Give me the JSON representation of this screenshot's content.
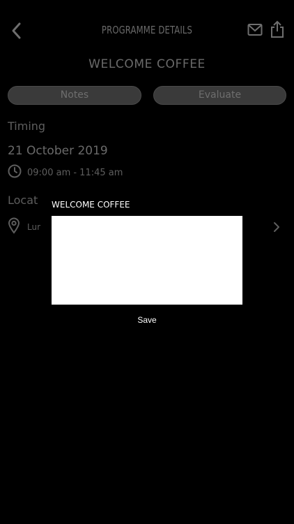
{
  "header": {
    "title": "PROGRAMME DETAILS",
    "back_icon": "chevron-left-icon",
    "mail_icon": "mail-icon",
    "share_icon": "share-icon"
  },
  "programme": {
    "title": "WELCOME COFFEE"
  },
  "tabs": {
    "notes": "Notes",
    "evaluate": "Evaluate"
  },
  "timing": {
    "label": "Timing",
    "date": "21 October 2019",
    "time": "09:00 am - 11:45 am"
  },
  "location": {
    "label": "Locat",
    "value": "Lur"
  },
  "modal": {
    "title": "WELCOME COFFEE",
    "note_value": "",
    "save_label": "Save"
  },
  "colors": {
    "background": "#000000",
    "dim_text": "#5e5e5e",
    "pill_bg": "#3a3a3a",
    "modal_box": "#ffffff"
  }
}
